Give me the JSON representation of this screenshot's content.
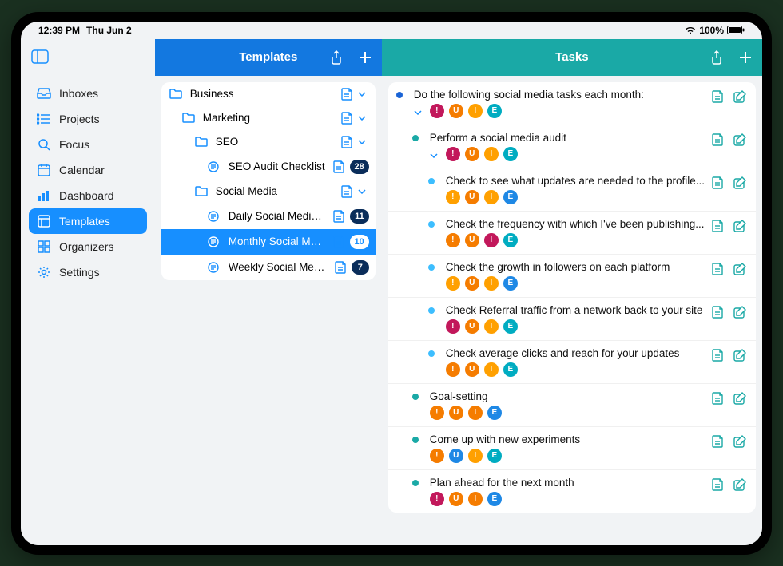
{
  "status": {
    "time": "12:39 PM",
    "date": "Thu Jun 2",
    "battery": "100%"
  },
  "sidebar": {
    "items": [
      {
        "label": "Inboxes",
        "icon": "inbox"
      },
      {
        "label": "Projects",
        "icon": "list"
      },
      {
        "label": "Focus",
        "icon": "search"
      },
      {
        "label": "Calendar",
        "icon": "calendar"
      },
      {
        "label": "Dashboard",
        "icon": "chart"
      },
      {
        "label": "Templates",
        "icon": "template",
        "active": true
      },
      {
        "label": "Organizers",
        "icon": "grid"
      },
      {
        "label": "Settings",
        "icon": "gear"
      }
    ]
  },
  "templates": {
    "title": "Templates",
    "tree": [
      {
        "label": "Business",
        "type": "folder",
        "depth": 0
      },
      {
        "label": "Marketing",
        "type": "folder",
        "depth": 1
      },
      {
        "label": "SEO",
        "type": "folder",
        "depth": 2
      },
      {
        "label": "SEO Audit Checklist",
        "type": "template",
        "depth": 3,
        "count": "28"
      },
      {
        "label": "Social Media",
        "type": "folder",
        "depth": 2
      },
      {
        "label": "Daily Social Media Ma...",
        "type": "template",
        "depth": 3,
        "count": "11"
      },
      {
        "label": "Monthly Social Media...",
        "type": "template",
        "depth": 3,
        "count": "10",
        "selected": true
      },
      {
        "label": "Weekly Social Media...",
        "type": "template",
        "depth": 3,
        "count": "7"
      }
    ]
  },
  "tasks": {
    "title": "Tasks",
    "items": [
      {
        "title": "Do the following social media tasks each month:",
        "bullet": "blue",
        "depth": 0,
        "expandable": true,
        "tags": [
          "!:magenta",
          "U:orange",
          "I:amber",
          "E:teal"
        ]
      },
      {
        "title": "Perform a social media audit",
        "bullet": "teal",
        "depth": 1,
        "expandable": true,
        "tags": [
          "!:magenta",
          "U:orange",
          "I:amber",
          "E:teal"
        ]
      },
      {
        "title": "Check to see what updates are needed to the profile...",
        "bullet": "lblue",
        "depth": 2,
        "tags": [
          "!:amber",
          "U:orange",
          "I:amber",
          "E:blue"
        ]
      },
      {
        "title": "Check the frequency with which I've been publishing...",
        "bullet": "lblue",
        "depth": 2,
        "tags": [
          "!:orange",
          "U:orange",
          "I:magenta",
          "E:teal"
        ]
      },
      {
        "title": "Check the growth in followers on each platform",
        "bullet": "lblue",
        "depth": 2,
        "tags": [
          "!:amber",
          "U:orange",
          "I:amber",
          "E:blue"
        ]
      },
      {
        "title": "Check Referral traffic from a network back to your site",
        "bullet": "lblue",
        "depth": 2,
        "tags": [
          "!:magenta",
          "U:orange",
          "I:amber",
          "E:teal"
        ]
      },
      {
        "title": "Check average clicks and reach for your updates",
        "bullet": "lblue",
        "depth": 2,
        "tags": [
          "!:orange",
          "U:orange",
          "I:amber",
          "E:teal"
        ]
      },
      {
        "title": "Goal-setting",
        "bullet": "teal",
        "depth": 1,
        "tags": [
          "!:orange",
          "U:orange",
          "I:orange",
          "E:blue"
        ]
      },
      {
        "title": "Come up with new experiments",
        "bullet": "teal",
        "depth": 1,
        "tags": [
          "!:orange",
          "U:blue",
          "I:amber",
          "E:teal"
        ]
      },
      {
        "title": "Plan ahead for the next month",
        "bullet": "teal",
        "depth": 1,
        "tags": [
          "!:magenta",
          "U:orange",
          "I:orange",
          "E:blue"
        ]
      }
    ]
  }
}
